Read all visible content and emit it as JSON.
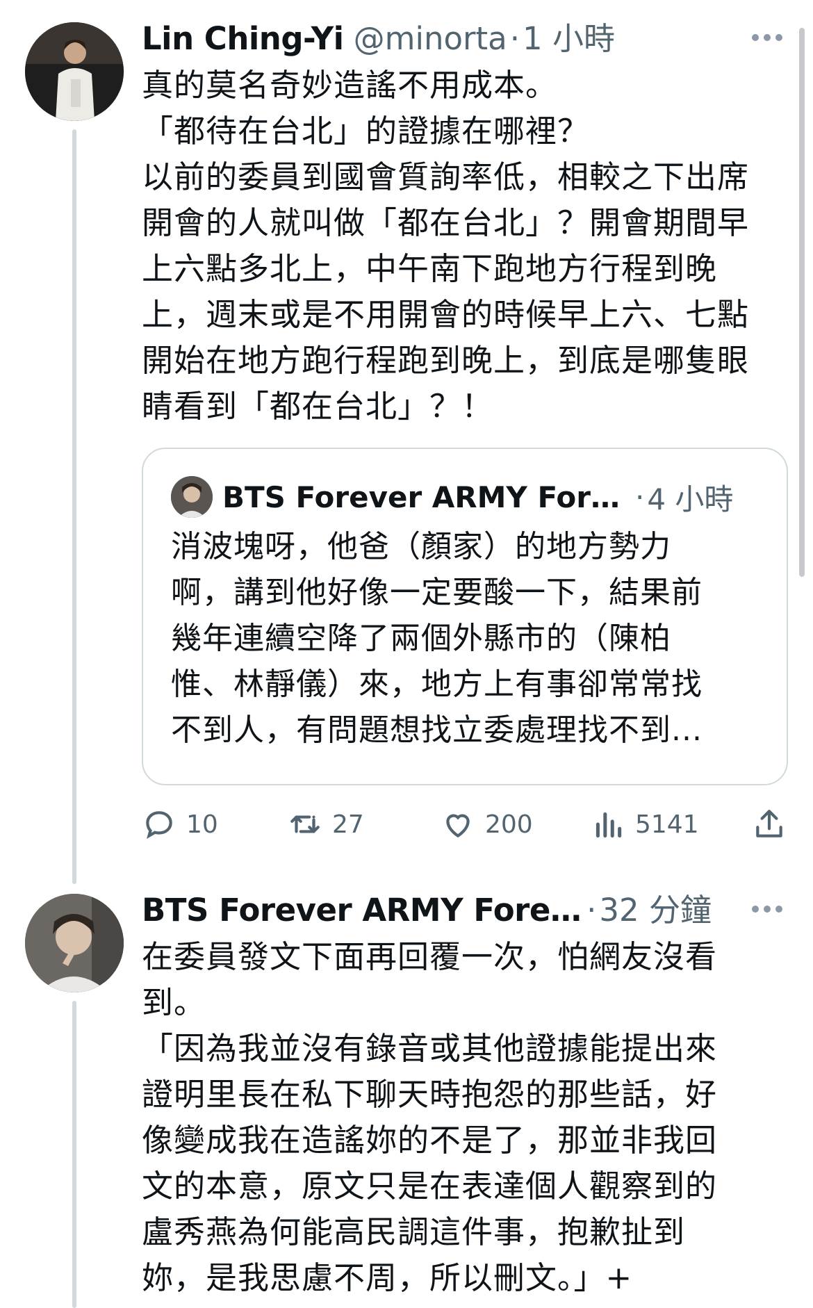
{
  "post1": {
    "author_name": "Lin Ching-Yi",
    "handle": "@minorta",
    "separator": "·",
    "time": "1 小時",
    "text": "真的莫名奇妙造謠不用成本。\n「都待在台北」的證據在哪裡？\n以前的委員到國會質詢率低，相較之下出席\n開會的人就叫做「都在台北」？開會期間早\n上六點多北上，中午南下跑地方行程到晚\n上，週末或是不用開會的時候早上六、七點\n開始在地方跑行程跑到晚上，到底是哪隻眼\n睛看到「都在台北」？！",
    "quote": {
      "author_name": "BTS Forever ARMY Forev...",
      "separator": "·",
      "time": "4 小時",
      "text": "消波塊呀，他爸（顏家）的地方勢力\n啊，講到他好像一定要酸一下，結果前\n幾年連續空降了兩個外縣市的（陳柏\n惟、林靜儀）來，地方上有事卻常常找\n不到人，有問題想找立委處理找不到..."
    },
    "actions": {
      "replies": "10",
      "retweets": "27",
      "likes": "200",
      "views": "5141"
    }
  },
  "post2": {
    "author_name": "BTS Forever ARMY Forever...",
    "separator": "·",
    "time": "32 分鐘",
    "text": "在委員發文下面再回覆一次，怕網友沒看\n到。\n「因為我並沒有錄音或其他證據能提出來\n證明里長在私下聊天時抱怨的那些話，好\n像變成我在造謠妳的不是了，那並非我回\n文的本意，原文只是在表達個人觀察到的\n盧秀燕為何能高民調這件事，抱歉扯到\n妳，是我思慮不周，所以刪文。」+"
  },
  "colors": {
    "text": "#0f1419",
    "secondary": "#536471",
    "border": "#cfd9de"
  }
}
